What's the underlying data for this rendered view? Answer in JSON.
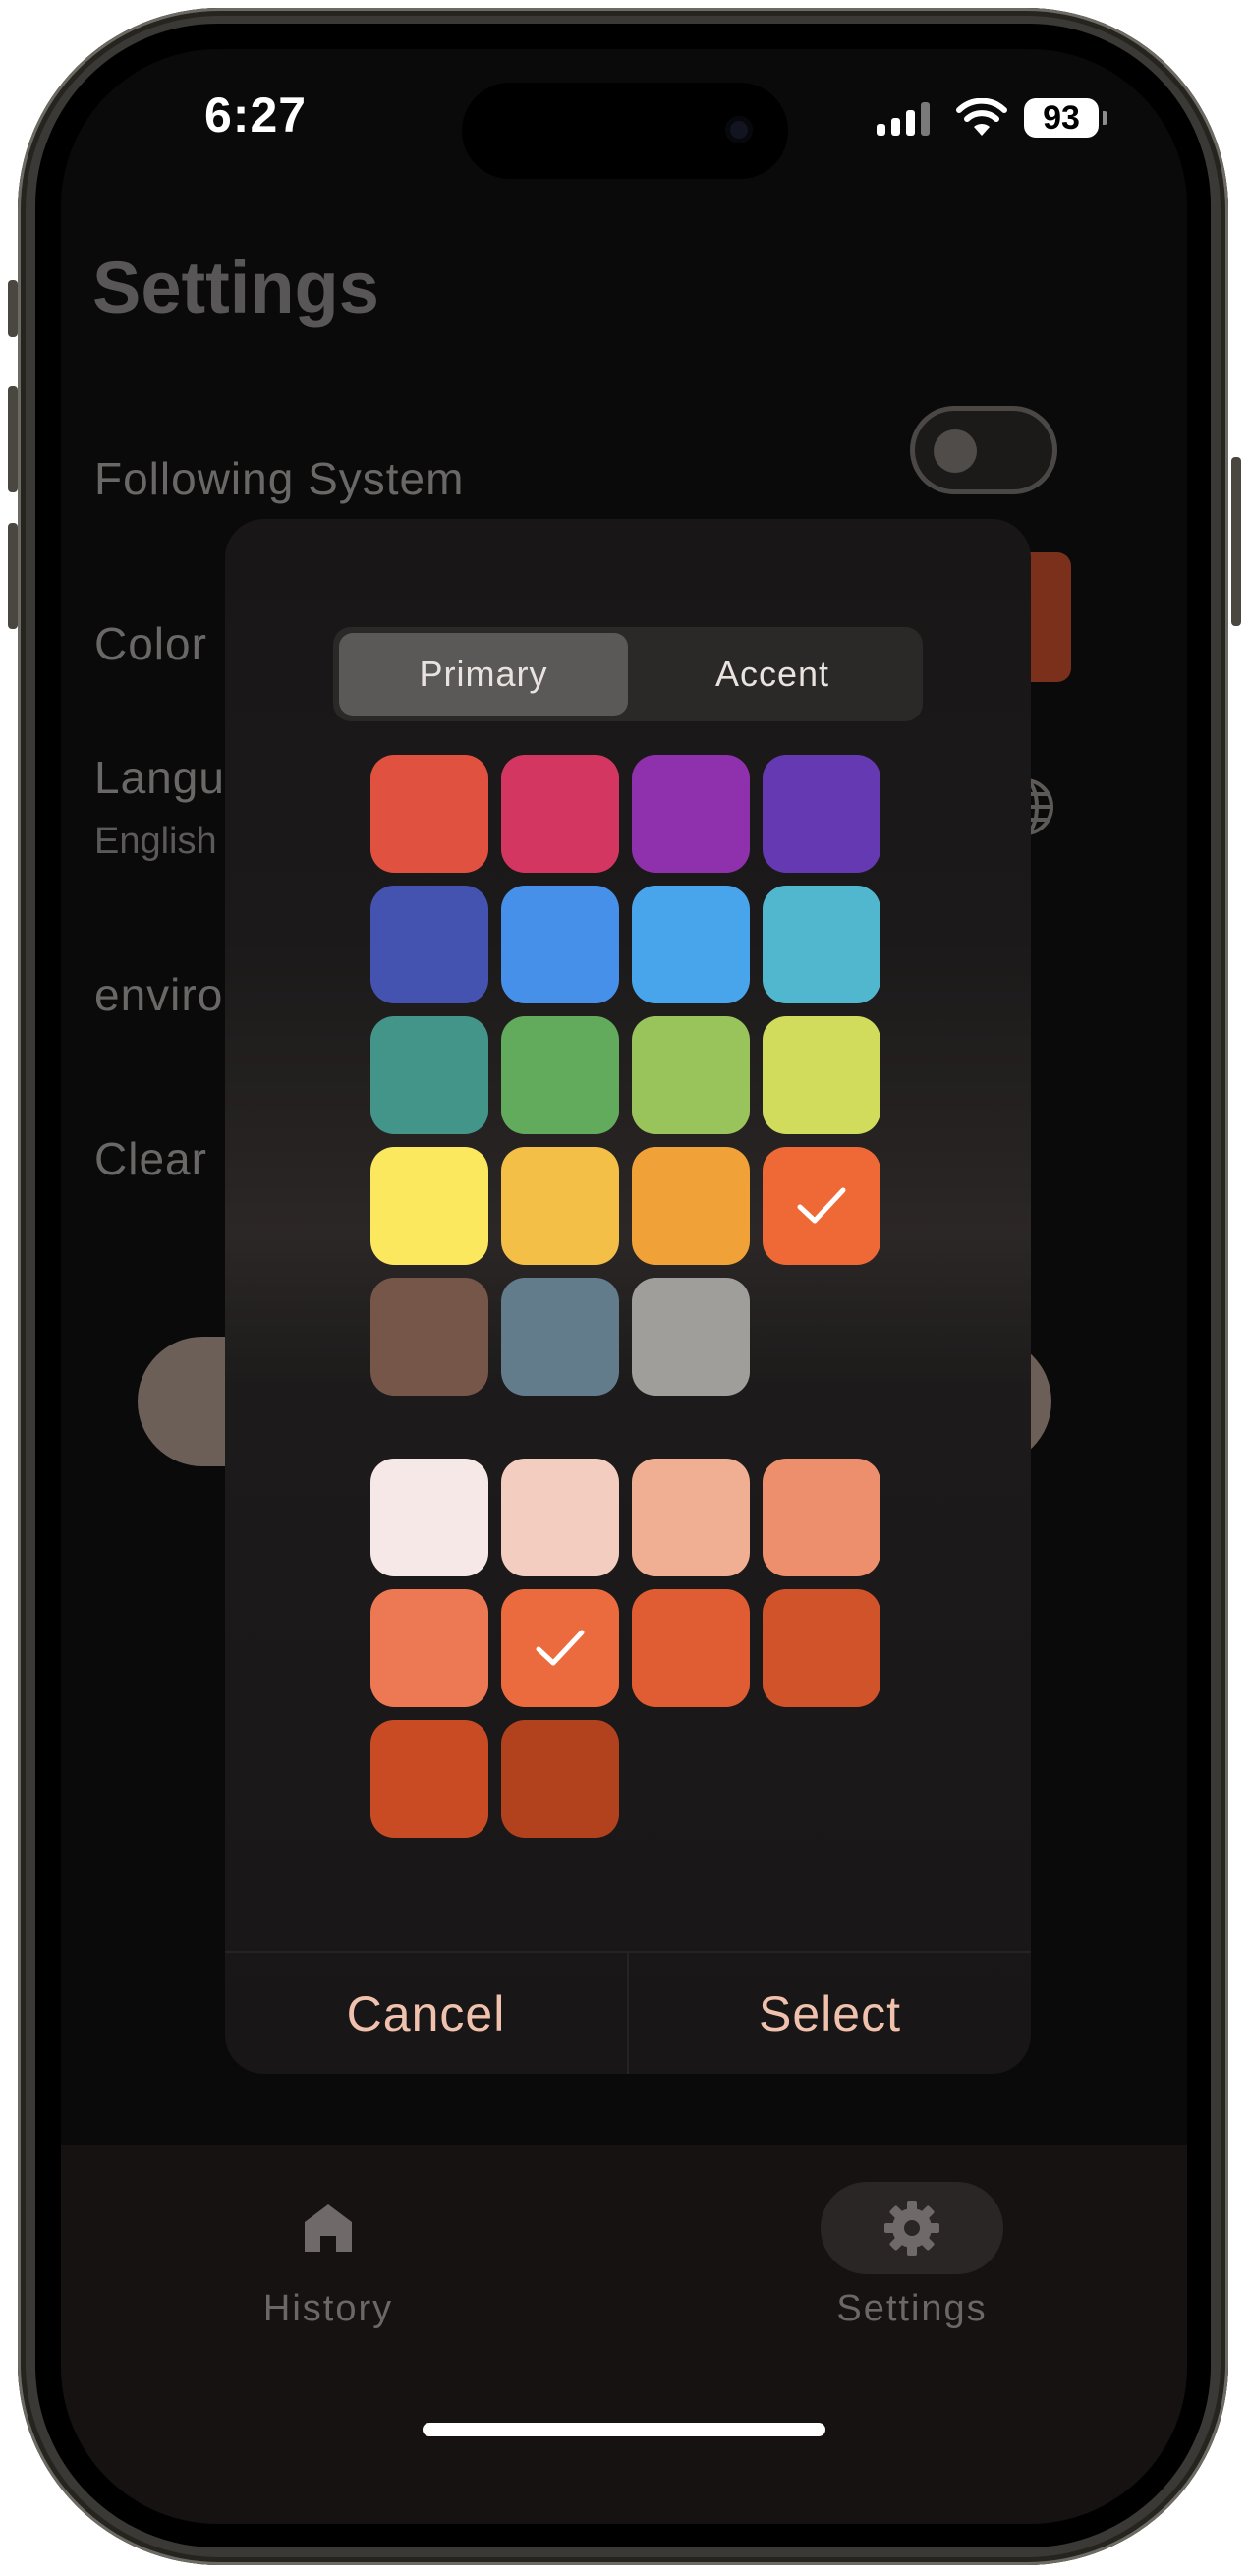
{
  "status_bar": {
    "time": "6:27",
    "battery": "93"
  },
  "settings": {
    "title": "Settings",
    "rows": {
      "following_system": "Following System",
      "color": "Color",
      "language": "Langu",
      "language_value": "English",
      "environment": "enviro",
      "clear": "Clear"
    }
  },
  "modal": {
    "tabs": {
      "primary": "Primary",
      "accent": "Accent"
    },
    "primary_colors": [
      "#e1513f",
      "#d43662",
      "#8f30ac",
      "#6439b1",
      "#4452b0",
      "#4690e9",
      "#48a5ec",
      "#51b7cf",
      "#43958a",
      "#63ab5c",
      "#99c45c",
      "#d1db5c",
      "#fbe85f",
      "#f3bf47",
      "#f0a238",
      "#ee6936",
      "#755649",
      "#637c8b",
      "#9f9e9b"
    ],
    "primary_selected_index": 15,
    "accent_colors": [
      "#f6e8e6",
      "#f3cdbf",
      "#f0ae93",
      "#ed8f6d",
      "#ec7953",
      "#eb6a3e",
      "#e05d33",
      "#d15329",
      "#c84b24",
      "#b2411e"
    ],
    "accent_selected_index": 5,
    "cancel": "Cancel",
    "select": "Select"
  },
  "nav": {
    "history": "History",
    "settings": "Settings"
  }
}
